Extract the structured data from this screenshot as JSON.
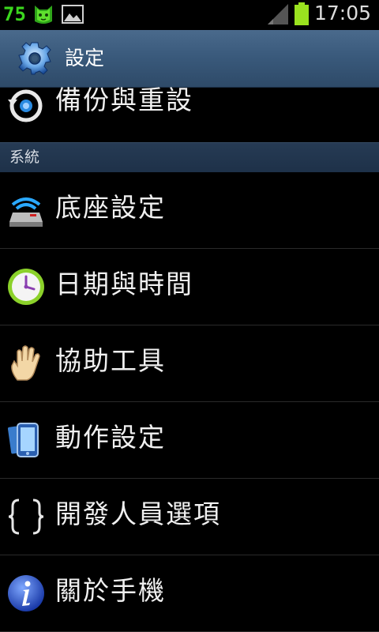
{
  "statusbar": {
    "battery_percent_text": "75",
    "time": "17:05",
    "icons": [
      "cat-notification-icon",
      "gallery-icon",
      "signal-icon",
      "battery-icon"
    ]
  },
  "titlebar": {
    "icon": "gear-icon",
    "title": "設定"
  },
  "list": {
    "partial_item": {
      "label": "備份與重設",
      "icon": "backup-reset-icon"
    },
    "section_system": "系統",
    "items": [
      {
        "label": "底座設定",
        "icon": "dock-icon"
      },
      {
        "label": "日期與時間",
        "icon": "clock-icon"
      },
      {
        "label": "協助工具",
        "icon": "hand-icon"
      },
      {
        "label": "動作設定",
        "icon": "motion-phone-icon"
      },
      {
        "label": "開發人員選項",
        "icon": "braces-icon"
      },
      {
        "label": "關於手機",
        "icon": "info-icon"
      }
    ]
  },
  "colors": {
    "battery_text": "#3bd61e",
    "titlebar": "#3a5a7c",
    "section_header": "#22364e",
    "background": "#000000"
  }
}
